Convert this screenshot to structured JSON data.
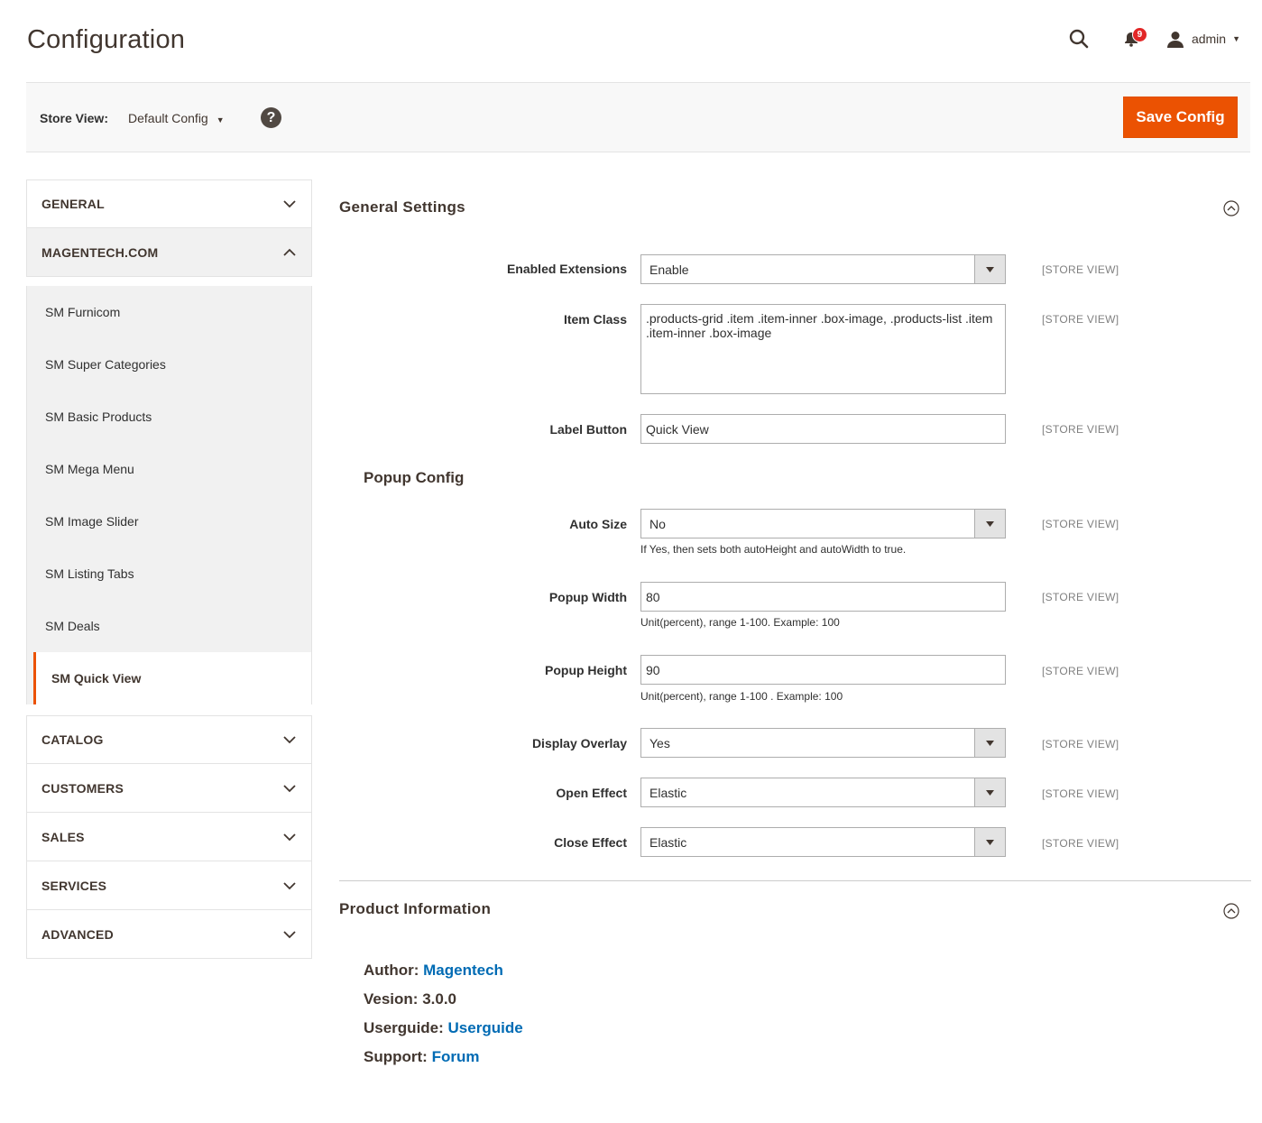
{
  "header": {
    "title": "Configuration",
    "notification_count": "9",
    "user_name": "admin"
  },
  "store_bar": {
    "label": "Store View:",
    "selected": "Default Config",
    "help": "?",
    "save_label": "Save Config"
  },
  "sidebar": {
    "tabs": [
      {
        "label": "GENERAL"
      },
      {
        "label": "MAGENTECH.COM"
      },
      {
        "label": "CATALOG"
      },
      {
        "label": "CUSTOMERS"
      },
      {
        "label": "SALES"
      },
      {
        "label": "SERVICES"
      },
      {
        "label": "ADVANCED"
      }
    ],
    "magentech_items": [
      {
        "label": "SM Furnicom"
      },
      {
        "label": "SM Super Categories"
      },
      {
        "label": "SM Basic Products"
      },
      {
        "label": "SM Mega Menu"
      },
      {
        "label": "SM Image Slider"
      },
      {
        "label": "SM Listing Tabs"
      },
      {
        "label": "SM Deals"
      },
      {
        "label": "SM Quick View"
      }
    ]
  },
  "general_settings": {
    "title": "General Settings",
    "enabled_extensions": {
      "label": "Enabled Extensions",
      "value": "Enable",
      "scope": "[STORE VIEW]"
    },
    "item_class": {
      "label": "Item Class",
      "value": ".products-grid .item .item-inner .box-image, .products-list .item .item-inner .box-image",
      "scope": "[STORE VIEW]"
    },
    "label_button": {
      "label": "Label Button",
      "value": "Quick View",
      "scope": "[STORE VIEW]"
    }
  },
  "popup_config": {
    "title": "Popup Config",
    "auto_size": {
      "label": "Auto Size",
      "value": "No",
      "note": "If Yes, then sets both autoHeight and autoWidth to true.",
      "scope": "[STORE VIEW]"
    },
    "popup_width": {
      "label": "Popup Width",
      "value": "80",
      "note": "Unit(percent), range 1-100. Example: 100",
      "scope": "[STORE VIEW]"
    },
    "popup_height": {
      "label": "Popup Height",
      "value": "90",
      "note": "Unit(percent), range 1-100 . Example: 100",
      "scope": "[STORE VIEW]"
    },
    "display_overlay": {
      "label": "Display Overlay",
      "value": "Yes",
      "scope": "[STORE VIEW]"
    },
    "open_effect": {
      "label": "Open Effect",
      "value": "Elastic",
      "scope": "[STORE VIEW]"
    },
    "close_effect": {
      "label": "Close Effect",
      "value": "Elastic",
      "scope": "[STORE VIEW]"
    }
  },
  "product_info": {
    "title": "Product Information",
    "author_key": "Author:",
    "author_val": "Magentech",
    "version_key": "Vesion:",
    "version_val": "3.0.0",
    "guide_key": "Userguide:",
    "guide_val": "Userguide",
    "support_key": "Support:",
    "support_val": "Forum"
  },
  "colors": {
    "accent": "#eb5202",
    "link": "#006bb4",
    "badge": "#e22626"
  }
}
